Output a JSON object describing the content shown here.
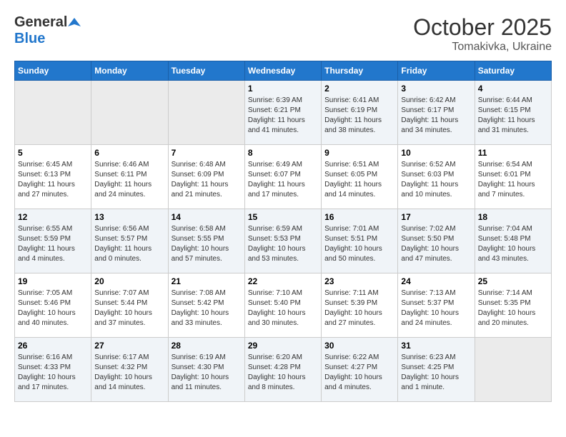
{
  "header": {
    "logo_general": "General",
    "logo_blue": "Blue",
    "month_title": "October 2025",
    "subtitle": "Tomakivka, Ukraine"
  },
  "weekdays": [
    "Sunday",
    "Monday",
    "Tuesday",
    "Wednesday",
    "Thursday",
    "Friday",
    "Saturday"
  ],
  "weeks": [
    [
      {
        "day": "",
        "info": ""
      },
      {
        "day": "",
        "info": ""
      },
      {
        "day": "",
        "info": ""
      },
      {
        "day": "1",
        "info": "Sunrise: 6:39 AM\nSunset: 6:21 PM\nDaylight: 11 hours\nand 41 minutes."
      },
      {
        "day": "2",
        "info": "Sunrise: 6:41 AM\nSunset: 6:19 PM\nDaylight: 11 hours\nand 38 minutes."
      },
      {
        "day": "3",
        "info": "Sunrise: 6:42 AM\nSunset: 6:17 PM\nDaylight: 11 hours\nand 34 minutes."
      },
      {
        "day": "4",
        "info": "Sunrise: 6:44 AM\nSunset: 6:15 PM\nDaylight: 11 hours\nand 31 minutes."
      }
    ],
    [
      {
        "day": "5",
        "info": "Sunrise: 6:45 AM\nSunset: 6:13 PM\nDaylight: 11 hours\nand 27 minutes."
      },
      {
        "day": "6",
        "info": "Sunrise: 6:46 AM\nSunset: 6:11 PM\nDaylight: 11 hours\nand 24 minutes."
      },
      {
        "day": "7",
        "info": "Sunrise: 6:48 AM\nSunset: 6:09 PM\nDaylight: 11 hours\nand 21 minutes."
      },
      {
        "day": "8",
        "info": "Sunrise: 6:49 AM\nSunset: 6:07 PM\nDaylight: 11 hours\nand 17 minutes."
      },
      {
        "day": "9",
        "info": "Sunrise: 6:51 AM\nSunset: 6:05 PM\nDaylight: 11 hours\nand 14 minutes."
      },
      {
        "day": "10",
        "info": "Sunrise: 6:52 AM\nSunset: 6:03 PM\nDaylight: 11 hours\nand 10 minutes."
      },
      {
        "day": "11",
        "info": "Sunrise: 6:54 AM\nSunset: 6:01 PM\nDaylight: 11 hours\nand 7 minutes."
      }
    ],
    [
      {
        "day": "12",
        "info": "Sunrise: 6:55 AM\nSunset: 5:59 PM\nDaylight: 11 hours\nand 4 minutes."
      },
      {
        "day": "13",
        "info": "Sunrise: 6:56 AM\nSunset: 5:57 PM\nDaylight: 11 hours\nand 0 minutes."
      },
      {
        "day": "14",
        "info": "Sunrise: 6:58 AM\nSunset: 5:55 PM\nDaylight: 10 hours\nand 57 minutes."
      },
      {
        "day": "15",
        "info": "Sunrise: 6:59 AM\nSunset: 5:53 PM\nDaylight: 10 hours\nand 53 minutes."
      },
      {
        "day": "16",
        "info": "Sunrise: 7:01 AM\nSunset: 5:51 PM\nDaylight: 10 hours\nand 50 minutes."
      },
      {
        "day": "17",
        "info": "Sunrise: 7:02 AM\nSunset: 5:50 PM\nDaylight: 10 hours\nand 47 minutes."
      },
      {
        "day": "18",
        "info": "Sunrise: 7:04 AM\nSunset: 5:48 PM\nDaylight: 10 hours\nand 43 minutes."
      }
    ],
    [
      {
        "day": "19",
        "info": "Sunrise: 7:05 AM\nSunset: 5:46 PM\nDaylight: 10 hours\nand 40 minutes."
      },
      {
        "day": "20",
        "info": "Sunrise: 7:07 AM\nSunset: 5:44 PM\nDaylight: 10 hours\nand 37 minutes."
      },
      {
        "day": "21",
        "info": "Sunrise: 7:08 AM\nSunset: 5:42 PM\nDaylight: 10 hours\nand 33 minutes."
      },
      {
        "day": "22",
        "info": "Sunrise: 7:10 AM\nSunset: 5:40 PM\nDaylight: 10 hours\nand 30 minutes."
      },
      {
        "day": "23",
        "info": "Sunrise: 7:11 AM\nSunset: 5:39 PM\nDaylight: 10 hours\nand 27 minutes."
      },
      {
        "day": "24",
        "info": "Sunrise: 7:13 AM\nSunset: 5:37 PM\nDaylight: 10 hours\nand 24 minutes."
      },
      {
        "day": "25",
        "info": "Sunrise: 7:14 AM\nSunset: 5:35 PM\nDaylight: 10 hours\nand 20 minutes."
      }
    ],
    [
      {
        "day": "26",
        "info": "Sunrise: 6:16 AM\nSunset: 4:33 PM\nDaylight: 10 hours\nand 17 minutes."
      },
      {
        "day": "27",
        "info": "Sunrise: 6:17 AM\nSunset: 4:32 PM\nDaylight: 10 hours\nand 14 minutes."
      },
      {
        "day": "28",
        "info": "Sunrise: 6:19 AM\nSunset: 4:30 PM\nDaylight: 10 hours\nand 11 minutes."
      },
      {
        "day": "29",
        "info": "Sunrise: 6:20 AM\nSunset: 4:28 PM\nDaylight: 10 hours\nand 8 minutes."
      },
      {
        "day": "30",
        "info": "Sunrise: 6:22 AM\nSunset: 4:27 PM\nDaylight: 10 hours\nand 4 minutes."
      },
      {
        "day": "31",
        "info": "Sunrise: 6:23 AM\nSunset: 4:25 PM\nDaylight: 10 hours\nand 1 minute."
      },
      {
        "day": "",
        "info": ""
      }
    ]
  ]
}
